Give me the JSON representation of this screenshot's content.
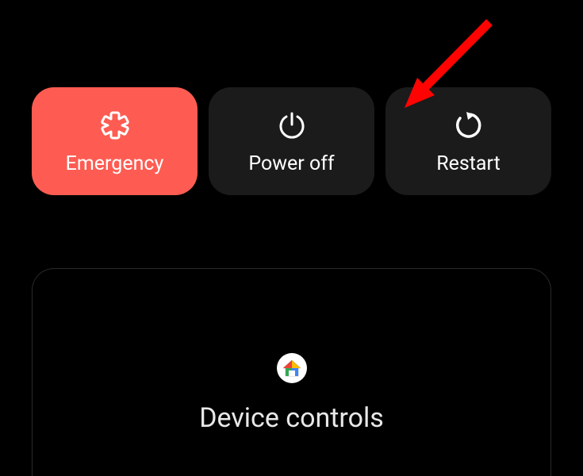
{
  "power_menu": {
    "emergency_label": "Emergency",
    "power_off_label": "Power off",
    "restart_label": "Restart"
  },
  "device_controls": {
    "title": "Device controls"
  },
  "colors": {
    "emergency": "#fe5c52",
    "dark_button": "#1b1b1b",
    "annotation_arrow": "#ff0302"
  }
}
